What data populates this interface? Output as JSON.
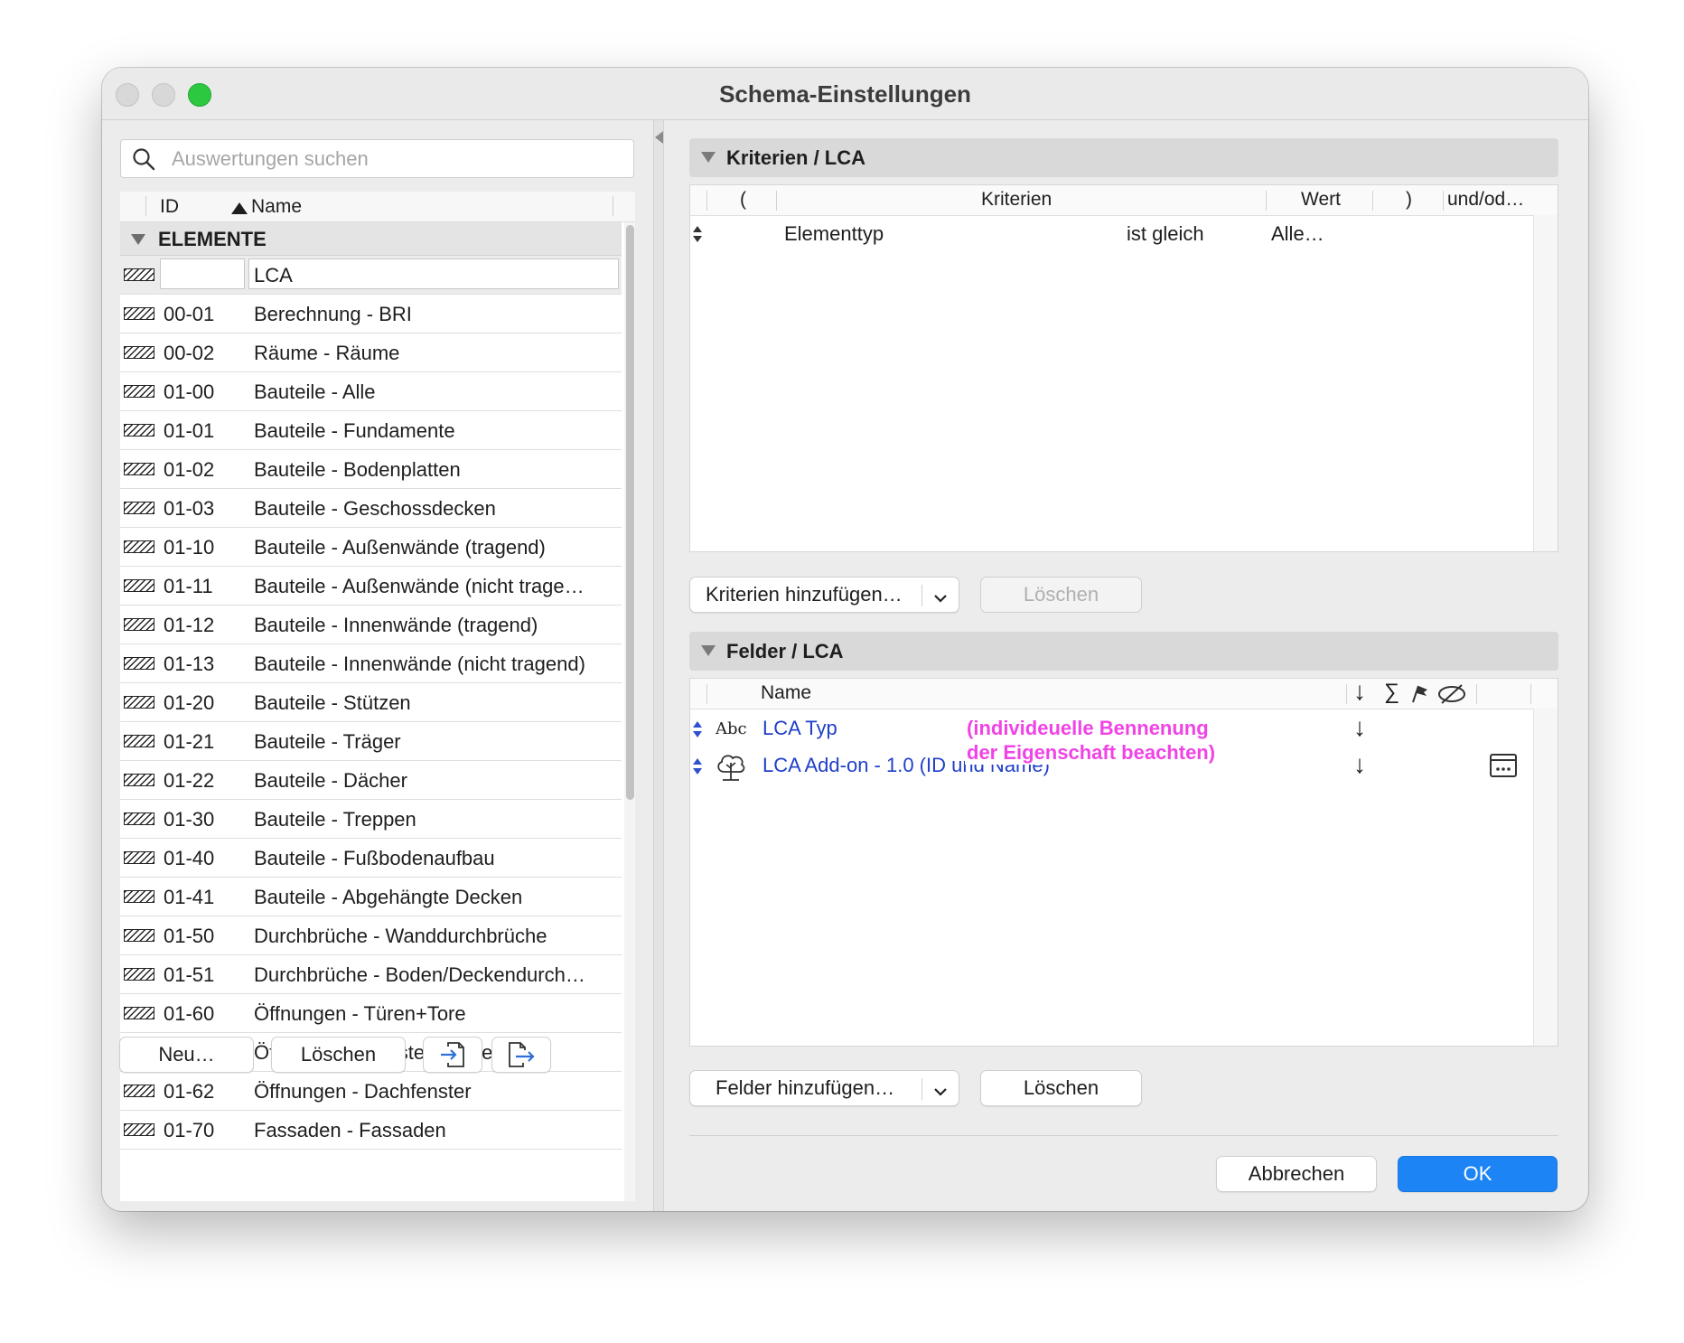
{
  "window": {
    "title": "Schema-Einstellungen"
  },
  "left": {
    "search_placeholder": "Auswertungen suchen",
    "col_id": "ID",
    "col_name": "Name",
    "group": "ELEMENTE",
    "selected_name": "LCA",
    "rows": [
      {
        "id": "00-01",
        "name": "Berechnung - BRI"
      },
      {
        "id": "00-02",
        "name": "Räume - Räume"
      },
      {
        "id": "01-00",
        "name": "Bauteile - Alle"
      },
      {
        "id": "01-01",
        "name": "Bauteile - Fundamente"
      },
      {
        "id": "01-02",
        "name": "Bauteile - Bodenplatten"
      },
      {
        "id": "01-03",
        "name": "Bauteile - Geschossdecken"
      },
      {
        "id": "01-10",
        "name": "Bauteile - Außenwände (tragend)"
      },
      {
        "id": "01-11",
        "name": "Bauteile - Außenwände (nicht trage…"
      },
      {
        "id": "01-12",
        "name": "Bauteile - Innenwände (tragend)"
      },
      {
        "id": "01-13",
        "name": "Bauteile - Innenwände (nicht tragend)"
      },
      {
        "id": "01-20",
        "name": "Bauteile - Stützen"
      },
      {
        "id": "01-21",
        "name": "Bauteile - Träger"
      },
      {
        "id": "01-22",
        "name": "Bauteile - Dächer"
      },
      {
        "id": "01-30",
        "name": "Bauteile - Treppen"
      },
      {
        "id": "01-40",
        "name": "Bauteile - Fußbodenaufbau"
      },
      {
        "id": "01-41",
        "name": "Bauteile - Abgehängte Decken"
      },
      {
        "id": "01-50",
        "name": "Durchbrüche - Wanddurchbrüche"
      },
      {
        "id": "01-51",
        "name": "Durchbrüche - Boden/Deckendurch…"
      },
      {
        "id": "01-60",
        "name": "Öffnungen - Türen+Tore"
      },
      {
        "id": "01-61",
        "name": "Öffnungen - Fenster+Eckfenster"
      },
      {
        "id": "01-62",
        "name": "Öffnungen - Dachfenster"
      },
      {
        "id": "01-70",
        "name": "Fassaden - Fassaden"
      }
    ],
    "btn_new": "Neu…",
    "btn_delete": "Löschen"
  },
  "criteria": {
    "title": "Kriterien /  LCA",
    "col_open": "(",
    "col_criteria": "Kriterien",
    "col_value": "Wert",
    "col_close": ")",
    "col_andor": "und/od…",
    "row": {
      "type": "Elementtyp",
      "op": "ist gleich",
      "value": "Alle…"
    },
    "btn_add": "Kriterien hinzufügen…",
    "btn_delete": "Löschen"
  },
  "fields": {
    "title": "Felder /  LCA",
    "col_name": "Name",
    "col_sigma": "∑",
    "rows": [
      {
        "icon_text": "Abc",
        "name": "LCA Typ",
        "arrow": "↓"
      },
      {
        "name": "LCA Add-on - 1.0 (ID und Name)",
        "arrow": "↓"
      }
    ],
    "header_arrow": "↓",
    "note_line1": "(individeuelle Bennenung",
    "note_line2": "der Eigenschaft beachten)",
    "btn_add": "Felder hinzufügen…",
    "btn_delete": "Löschen"
  },
  "footer": {
    "cancel": "Abbrechen",
    "ok": "OK"
  },
  "colors": {
    "ok_blue": "#1d84f5",
    "note_magenta": "#f043e6",
    "field_blue": "#1f3fc8",
    "zoom_green": "#2bc840"
  }
}
